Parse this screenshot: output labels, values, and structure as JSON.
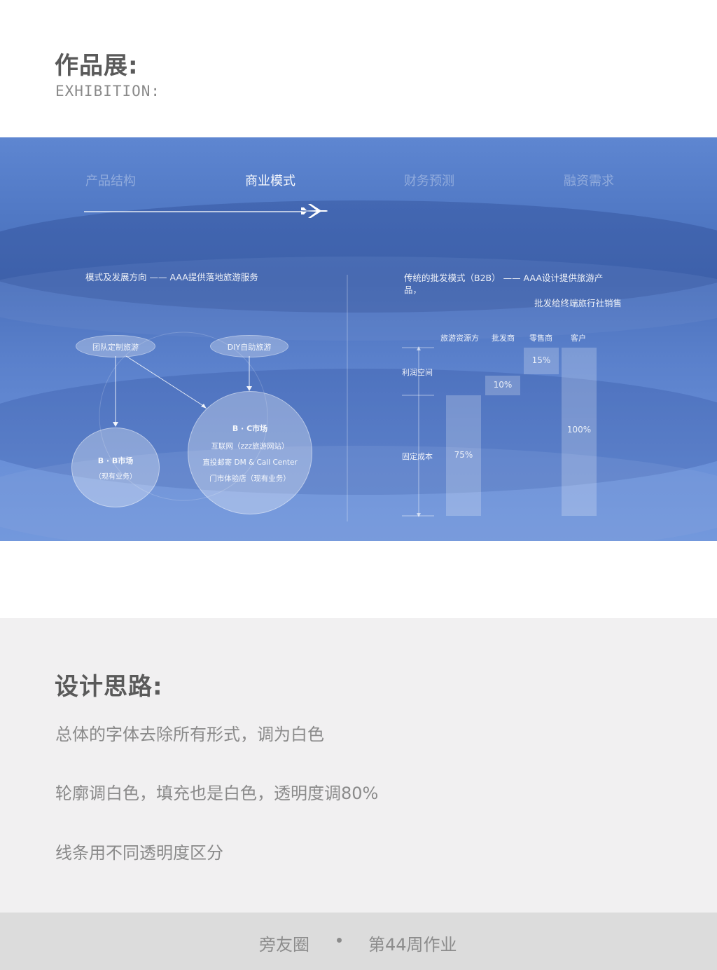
{
  "header": {
    "title": "作品展:",
    "subtitle": "EXHIBITION:"
  },
  "slide": {
    "nav": [
      "产品结构",
      "商业模式",
      "财务预测",
      "融资需求"
    ],
    "left": {
      "heading": "模式及发展方向 —— AAA提供落地旅游服务",
      "ellipse_a": "团队定制旅游",
      "ellipse_b": "DIY自助旅游",
      "b2b": {
        "title": "B · B市场",
        "sub": "（现有业务）"
      },
      "b2c": {
        "title": "B · C市场",
        "line1": "互联网（zzz旅游网站）",
        "line2": "直投邮寄 DM & Call Center",
        "line3": "门市体验店（现有业务）"
      }
    },
    "right": {
      "heading_line1": "传统的批发模式（B2B） —— AAA设计提供旅游产",
      "heading_line2": "品，",
      "heading_line3": "批发给终端旅行社销售",
      "columns": [
        "旅游资源方",
        "批发商",
        "零售商",
        "客户"
      ],
      "row_labels": [
        "利润空间",
        "固定成本"
      ],
      "bars": [
        "75%",
        "10%",
        "15%",
        "100%"
      ]
    }
  },
  "notes": {
    "title": "设计思路:",
    "lines": [
      "总体的字体去除所有形式，调为白色",
      "轮廓调白色，填充也是白色，透明度调80%",
      "线条用不同透明度区分"
    ]
  },
  "footer": {
    "left": "旁友圈",
    "separator": "•",
    "right": "第44周作业"
  }
}
